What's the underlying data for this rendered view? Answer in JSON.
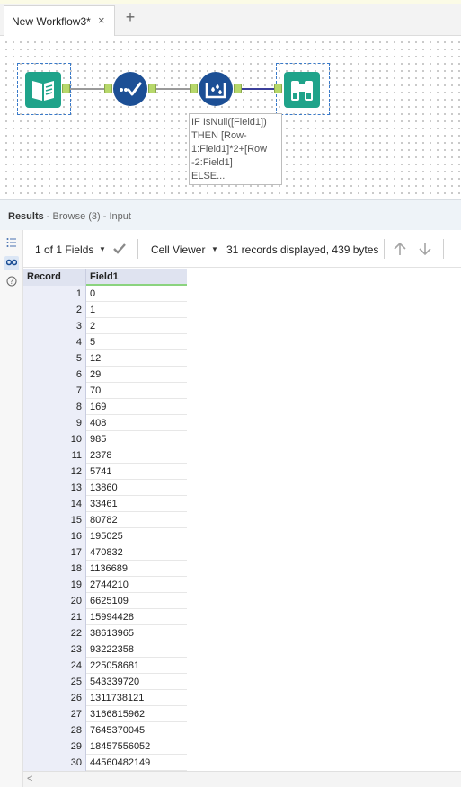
{
  "tabs": {
    "active_label": "New Workflow3*",
    "close_glyph": "×",
    "new_tab_glyph": "+"
  },
  "canvas": {
    "tools": [
      {
        "name": "input-tool-icon",
        "color": "#1fa38a"
      },
      {
        "name": "select-tool-icon",
        "color": "#1c4f95"
      },
      {
        "name": "multi-row-formula-tool-icon",
        "color": "#1c4f95"
      },
      {
        "name": "browse-tool-icon",
        "color": "#1fa38a"
      }
    ],
    "annotation": "IF IsNull([Field1])\nTHEN [Row-\n1:Field1]*2+[Row\n-2:Field1]\nELSE..."
  },
  "results": {
    "title": "Results",
    "subtitle": " - Browse (3) - Input"
  },
  "toolbar": {
    "fields_selector": "1 of 1 Fields",
    "viewer_selector": "Cell Viewer",
    "records_info": "31 records displayed, 439 bytes"
  },
  "grid": {
    "columns": [
      "Record",
      "Field1"
    ],
    "rows": [
      [
        "1",
        "0"
      ],
      [
        "2",
        "1"
      ],
      [
        "3",
        "2"
      ],
      [
        "4",
        "5"
      ],
      [
        "5",
        "12"
      ],
      [
        "6",
        "29"
      ],
      [
        "7",
        "70"
      ],
      [
        "8",
        "169"
      ],
      [
        "9",
        "408"
      ],
      [
        "10",
        "985"
      ],
      [
        "11",
        "2378"
      ],
      [
        "12",
        "5741"
      ],
      [
        "13",
        "13860"
      ],
      [
        "14",
        "33461"
      ],
      [
        "15",
        "80782"
      ],
      [
        "16",
        "195025"
      ],
      [
        "17",
        "470832"
      ],
      [
        "18",
        "1136689"
      ],
      [
        "19",
        "2744210"
      ],
      [
        "20",
        "6625109"
      ],
      [
        "21",
        "15994428"
      ],
      [
        "22",
        "38613965"
      ],
      [
        "23",
        "93222358"
      ],
      [
        "24",
        "225058681"
      ],
      [
        "25",
        "543339720"
      ],
      [
        "26",
        "1311738121"
      ],
      [
        "27",
        "3166815962"
      ],
      [
        "28",
        "7645370045"
      ],
      [
        "29",
        "18457556052"
      ],
      [
        "30",
        "44560482149"
      ]
    ]
  },
  "colors": {
    "accent_green": "#8bd37e",
    "tool_teal": "#1fa38a",
    "tool_blue": "#1c4f95"
  }
}
